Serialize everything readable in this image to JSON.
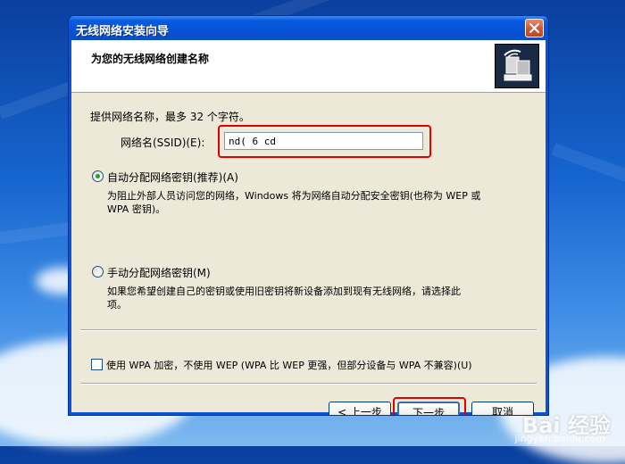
{
  "window": {
    "title": "无线网络安装向导",
    "header_title": "为您的无线网络创建名称"
  },
  "ssid": {
    "instruction": "提供网络名称，最多 32 个字符。",
    "label": "网络名(SSID)(E):",
    "value": "nd( 6 cd"
  },
  "options": {
    "auto": {
      "label": "自动分配网络密钥(推荐)(A)",
      "desc_line1": "为阻止外部人员访问您的网络，Windows 将为网络自动分配安全密钥(也称为 WEP 或",
      "desc_line2": "WPA 密钥)。",
      "checked": true
    },
    "manual": {
      "label": "手动分配网络密钥(M)",
      "desc_line1": "如果您希望创建自己的密钥或使用旧密钥将新设备添加到现有无线网络，请选择此",
      "desc_line2": "项。",
      "checked": false
    }
  },
  "wpa": {
    "label": "使用 WPA 加密，不使用 WEP (WPA 比 WEP 更强，但部分设备与 WPA 不兼容)(U)",
    "checked": false
  },
  "buttons": {
    "back": "< 上一步(B)",
    "next": "下一步(N) >",
    "cancel": "取消"
  },
  "watermark": {
    "text": "Bai 经验",
    "url": "jingyan.baidu.com"
  },
  "colors": {
    "highlight": "#e00000",
    "title_bar": "#0a5be0",
    "dialog_bg": "#ece9d8"
  },
  "icons": {
    "close": "close-icon",
    "header": "wireless-network-icon"
  }
}
